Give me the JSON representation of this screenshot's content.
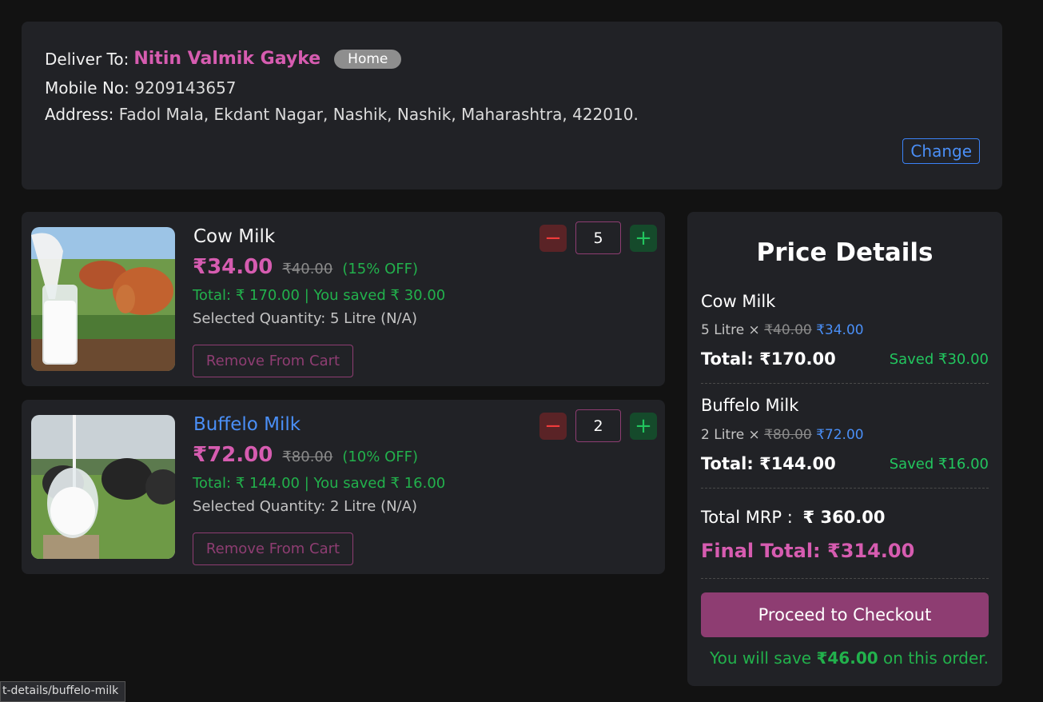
{
  "address": {
    "deliver_label": "Deliver To:",
    "name": "Nitin Valmik Gayke",
    "tag": "Home",
    "mobile_label": "Mobile No:",
    "mobile": "9209143657",
    "address_label": "Address:",
    "address": "Fadol Mala, Ekdant Nagar, Nashik, Nashik, Maharashtra, 422010.",
    "change_label": "Change"
  },
  "cart": [
    {
      "name": "Cow Milk",
      "price": "₹34.00",
      "mrp": "₹40.00",
      "off": "(15% OFF)",
      "total_line": "Total: ₹ 170.00 | You saved ₹ 30.00",
      "qty_line": "Selected Quantity: 5 Litre (N/A)",
      "quantity": "5",
      "remove_label": "Remove From Cart"
    },
    {
      "name": "Buffelo Milk",
      "price": "₹72.00",
      "mrp": "₹80.00",
      "off": "(10% OFF)",
      "total_line": "Total: ₹ 144.00 | You saved ₹ 16.00",
      "qty_line": "Selected Quantity: 2 Litre (N/A)",
      "quantity": "2",
      "remove_label": "Remove From Cart"
    }
  ],
  "price_details": {
    "title": "Price Details",
    "items": [
      {
        "name": "Cow Milk",
        "qty": "5 Litre ×",
        "mrp": "₹40.00",
        "price": "₹34.00",
        "total": "Total: ₹170.00",
        "saved": "Saved ₹30.00"
      },
      {
        "name": "Buffelo Milk",
        "qty": "2 Litre ×",
        "mrp": "₹80.00",
        "price": "₹72.00",
        "total": "Total: ₹144.00",
        "saved": "Saved ₹16.00"
      }
    ],
    "mrp_label": "Total MRP :",
    "mrp_value": "₹ 360.00",
    "final_total": "Final Total: ₹314.00",
    "checkout_label": "Proceed to Checkout",
    "save_prefix": "You will save",
    "save_amount": "₹46.00",
    "save_suffix": "on this order."
  },
  "status_bar": {
    "url": "t-details/buffelo-milk"
  },
  "colors": {
    "accent_pink": "#d65cb0",
    "link_blue": "#4a8ff7",
    "success_green": "#22b14c",
    "button_purple": "#8e3d72"
  },
  "icons": {
    "decrement": "minus-icon",
    "increment": "plus-icon"
  }
}
